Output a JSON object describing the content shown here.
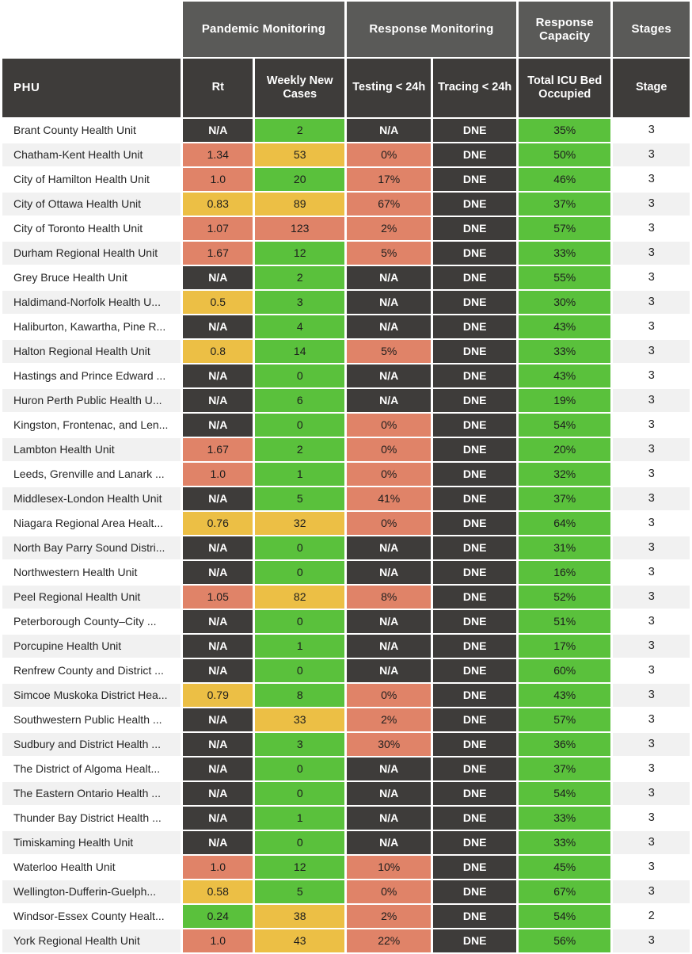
{
  "header": {
    "groups": [
      {
        "label": "",
        "key": "blank"
      },
      {
        "label": "Pandemic Monitoring",
        "key": "pandemic"
      },
      {
        "label": "Response Monitoring",
        "key": "response"
      },
      {
        "label": "Response Capacity",
        "key": "capacity"
      },
      {
        "label": "Stages",
        "key": "stages"
      }
    ],
    "columns": [
      {
        "label": "PHU"
      },
      {
        "label": "Rt"
      },
      {
        "label": "Weekly New Cases"
      },
      {
        "label": "Testing < 24h"
      },
      {
        "label": "Tracing < 24h"
      },
      {
        "label": "Total ICU Bed Occupied"
      },
      {
        "label": "Stage"
      }
    ]
  },
  "colors": {
    "green": "#5ac13c",
    "yellow": "#ecbf45",
    "red": "#e08368",
    "dark": "#3e3c3a",
    "group_header": "#5a5a58",
    "row_alt": "#f1f1f1",
    "page_background": "#ffffff"
  },
  "rows": [
    {
      "phu": "Brant County Health Unit",
      "rt": "N/A",
      "rt_c": "dark",
      "cases": "2",
      "cases_c": "green",
      "testing": "N/A",
      "testing_c": "dark",
      "tracing": "DNE",
      "tracing_c": "dark",
      "icu": "35%",
      "icu_c": "green",
      "stage": "3"
    },
    {
      "phu": "Chatham-Kent Health Unit",
      "rt": "1.34",
      "rt_c": "red",
      "cases": "53",
      "cases_c": "yellow",
      "testing": "0%",
      "testing_c": "red",
      "tracing": "DNE",
      "tracing_c": "dark",
      "icu": "50%",
      "icu_c": "green",
      "stage": "3"
    },
    {
      "phu": "City of Hamilton Health Unit",
      "rt": "1.0",
      "rt_c": "red",
      "cases": "20",
      "cases_c": "green",
      "testing": "17%",
      "testing_c": "red",
      "tracing": "DNE",
      "tracing_c": "dark",
      "icu": "46%",
      "icu_c": "green",
      "stage": "3"
    },
    {
      "phu": "City of Ottawa Health Unit",
      "rt": "0.83",
      "rt_c": "yellow",
      "cases": "89",
      "cases_c": "yellow",
      "testing": "67%",
      "testing_c": "red",
      "tracing": "DNE",
      "tracing_c": "dark",
      "icu": "37%",
      "icu_c": "green",
      "stage": "3"
    },
    {
      "phu": "City of Toronto Health Unit",
      "rt": "1.07",
      "rt_c": "red",
      "cases": "123",
      "cases_c": "red",
      "testing": "2%",
      "testing_c": "red",
      "tracing": "DNE",
      "tracing_c": "dark",
      "icu": "57%",
      "icu_c": "green",
      "stage": "3"
    },
    {
      "phu": "Durham Regional Health Unit",
      "rt": "1.67",
      "rt_c": "red",
      "cases": "12",
      "cases_c": "green",
      "testing": "5%",
      "testing_c": "red",
      "tracing": "DNE",
      "tracing_c": "dark",
      "icu": "33%",
      "icu_c": "green",
      "stage": "3"
    },
    {
      "phu": "Grey Bruce Health Unit",
      "rt": "N/A",
      "rt_c": "dark",
      "cases": "2",
      "cases_c": "green",
      "testing": "N/A",
      "testing_c": "dark",
      "tracing": "DNE",
      "tracing_c": "dark",
      "icu": "55%",
      "icu_c": "green",
      "stage": "3"
    },
    {
      "phu": "Haldimand-Norfolk Health U...",
      "rt": "0.5",
      "rt_c": "yellow",
      "cases": "3",
      "cases_c": "green",
      "testing": "N/A",
      "testing_c": "dark",
      "tracing": "DNE",
      "tracing_c": "dark",
      "icu": "30%",
      "icu_c": "green",
      "stage": "3"
    },
    {
      "phu": "Haliburton, Kawartha, Pine R...",
      "rt": "N/A",
      "rt_c": "dark",
      "cases": "4",
      "cases_c": "green",
      "testing": "N/A",
      "testing_c": "dark",
      "tracing": "DNE",
      "tracing_c": "dark",
      "icu": "43%",
      "icu_c": "green",
      "stage": "3"
    },
    {
      "phu": "Halton Regional Health Unit",
      "rt": "0.8",
      "rt_c": "yellow",
      "cases": "14",
      "cases_c": "green",
      "testing": "5%",
      "testing_c": "red",
      "tracing": "DNE",
      "tracing_c": "dark",
      "icu": "33%",
      "icu_c": "green",
      "stage": "3"
    },
    {
      "phu": "Hastings and Prince Edward ...",
      "rt": "N/A",
      "rt_c": "dark",
      "cases": "0",
      "cases_c": "green",
      "testing": "N/A",
      "testing_c": "dark",
      "tracing": "DNE",
      "tracing_c": "dark",
      "icu": "43%",
      "icu_c": "green",
      "stage": "3"
    },
    {
      "phu": "Huron Perth Public Health U...",
      "rt": "N/A",
      "rt_c": "dark",
      "cases": "6",
      "cases_c": "green",
      "testing": "N/A",
      "testing_c": "dark",
      "tracing": "DNE",
      "tracing_c": "dark",
      "icu": "19%",
      "icu_c": "green",
      "stage": "3"
    },
    {
      "phu": "Kingston, Frontenac, and Len...",
      "rt": "N/A",
      "rt_c": "dark",
      "cases": "0",
      "cases_c": "green",
      "testing": "0%",
      "testing_c": "red",
      "tracing": "DNE",
      "tracing_c": "dark",
      "icu": "54%",
      "icu_c": "green",
      "stage": "3"
    },
    {
      "phu": "Lambton Health Unit",
      "rt": "1.67",
      "rt_c": "red",
      "cases": "2",
      "cases_c": "green",
      "testing": "0%",
      "testing_c": "red",
      "tracing": "DNE",
      "tracing_c": "dark",
      "icu": "20%",
      "icu_c": "green",
      "stage": "3"
    },
    {
      "phu": "Leeds, Grenville and Lanark ...",
      "rt": "1.0",
      "rt_c": "red",
      "cases": "1",
      "cases_c": "green",
      "testing": "0%",
      "testing_c": "red",
      "tracing": "DNE",
      "tracing_c": "dark",
      "icu": "32%",
      "icu_c": "green",
      "stage": "3"
    },
    {
      "phu": "Middlesex-London Health Unit",
      "rt": "N/A",
      "rt_c": "dark",
      "cases": "5",
      "cases_c": "green",
      "testing": "41%",
      "testing_c": "red",
      "tracing": "DNE",
      "tracing_c": "dark",
      "icu": "37%",
      "icu_c": "green",
      "stage": "3"
    },
    {
      "phu": "Niagara Regional Area Healt...",
      "rt": "0.76",
      "rt_c": "yellow",
      "cases": "32",
      "cases_c": "yellow",
      "testing": "0%",
      "testing_c": "red",
      "tracing": "DNE",
      "tracing_c": "dark",
      "icu": "64%",
      "icu_c": "green",
      "stage": "3"
    },
    {
      "phu": "North Bay Parry Sound Distri...",
      "rt": "N/A",
      "rt_c": "dark",
      "cases": "0",
      "cases_c": "green",
      "testing": "N/A",
      "testing_c": "dark",
      "tracing": "DNE",
      "tracing_c": "dark",
      "icu": "31%",
      "icu_c": "green",
      "stage": "3"
    },
    {
      "phu": "Northwestern Health Unit",
      "rt": "N/A",
      "rt_c": "dark",
      "cases": "0",
      "cases_c": "green",
      "testing": "N/A",
      "testing_c": "dark",
      "tracing": "DNE",
      "tracing_c": "dark",
      "icu": "16%",
      "icu_c": "green",
      "stage": "3"
    },
    {
      "phu": "Peel Regional Health Unit",
      "rt": "1.05",
      "rt_c": "red",
      "cases": "82",
      "cases_c": "yellow",
      "testing": "8%",
      "testing_c": "red",
      "tracing": "DNE",
      "tracing_c": "dark",
      "icu": "52%",
      "icu_c": "green",
      "stage": "3"
    },
    {
      "phu": "Peterborough County–City ...",
      "rt": "N/A",
      "rt_c": "dark",
      "cases": "0",
      "cases_c": "green",
      "testing": "N/A",
      "testing_c": "dark",
      "tracing": "DNE",
      "tracing_c": "dark",
      "icu": "51%",
      "icu_c": "green",
      "stage": "3"
    },
    {
      "phu": "Porcupine Health Unit",
      "rt": "N/A",
      "rt_c": "dark",
      "cases": "1",
      "cases_c": "green",
      "testing": "N/A",
      "testing_c": "dark",
      "tracing": "DNE",
      "tracing_c": "dark",
      "icu": "17%",
      "icu_c": "green",
      "stage": "3"
    },
    {
      "phu": "Renfrew County and District ...",
      "rt": "N/A",
      "rt_c": "dark",
      "cases": "0",
      "cases_c": "green",
      "testing": "N/A",
      "testing_c": "dark",
      "tracing": "DNE",
      "tracing_c": "dark",
      "icu": "60%",
      "icu_c": "green",
      "stage": "3"
    },
    {
      "phu": "Simcoe Muskoka District Hea...",
      "rt": "0.79",
      "rt_c": "yellow",
      "cases": "8",
      "cases_c": "green",
      "testing": "0%",
      "testing_c": "red",
      "tracing": "DNE",
      "tracing_c": "dark",
      "icu": "43%",
      "icu_c": "green",
      "stage": "3"
    },
    {
      "phu": "Southwestern Public Health ...",
      "rt": "N/A",
      "rt_c": "dark",
      "cases": "33",
      "cases_c": "yellow",
      "testing": "2%",
      "testing_c": "red",
      "tracing": "DNE",
      "tracing_c": "dark",
      "icu": "57%",
      "icu_c": "green",
      "stage": "3"
    },
    {
      "phu": "Sudbury and District Health ...",
      "rt": "N/A",
      "rt_c": "dark",
      "cases": "3",
      "cases_c": "green",
      "testing": "30%",
      "testing_c": "red",
      "tracing": "DNE",
      "tracing_c": "dark",
      "icu": "36%",
      "icu_c": "green",
      "stage": "3"
    },
    {
      "phu": "The District of Algoma Healt...",
      "rt": "N/A",
      "rt_c": "dark",
      "cases": "0",
      "cases_c": "green",
      "testing": "N/A",
      "testing_c": "dark",
      "tracing": "DNE",
      "tracing_c": "dark",
      "icu": "37%",
      "icu_c": "green",
      "stage": "3"
    },
    {
      "phu": "The Eastern Ontario Health ...",
      "rt": "N/A",
      "rt_c": "dark",
      "cases": "0",
      "cases_c": "green",
      "testing": "N/A",
      "testing_c": "dark",
      "tracing": "DNE",
      "tracing_c": "dark",
      "icu": "54%",
      "icu_c": "green",
      "stage": "3"
    },
    {
      "phu": "Thunder Bay District Health ...",
      "rt": "N/A",
      "rt_c": "dark",
      "cases": "1",
      "cases_c": "green",
      "testing": "N/A",
      "testing_c": "dark",
      "tracing": "DNE",
      "tracing_c": "dark",
      "icu": "33%",
      "icu_c": "green",
      "stage": "3"
    },
    {
      "phu": "Timiskaming Health Unit",
      "rt": "N/A",
      "rt_c": "dark",
      "cases": "0",
      "cases_c": "green",
      "testing": "N/A",
      "testing_c": "dark",
      "tracing": "DNE",
      "tracing_c": "dark",
      "icu": "33%",
      "icu_c": "green",
      "stage": "3"
    },
    {
      "phu": "Waterloo Health Unit",
      "rt": "1.0",
      "rt_c": "red",
      "cases": "12",
      "cases_c": "green",
      "testing": "10%",
      "testing_c": "red",
      "tracing": "DNE",
      "tracing_c": "dark",
      "icu": "45%",
      "icu_c": "green",
      "stage": "3"
    },
    {
      "phu": "Wellington-Dufferin-Guelph...",
      "rt": "0.58",
      "rt_c": "yellow",
      "cases": "5",
      "cases_c": "green",
      "testing": "0%",
      "testing_c": "red",
      "tracing": "DNE",
      "tracing_c": "dark",
      "icu": "67%",
      "icu_c": "green",
      "stage": "3"
    },
    {
      "phu": "Windsor-Essex County Healt...",
      "rt": "0.24",
      "rt_c": "green",
      "cases": "38",
      "cases_c": "yellow",
      "testing": "2%",
      "testing_c": "red",
      "tracing": "DNE",
      "tracing_c": "dark",
      "icu": "54%",
      "icu_c": "green",
      "stage": "2"
    },
    {
      "phu": "York Regional Health Unit",
      "rt": "1.0",
      "rt_c": "red",
      "cases": "43",
      "cases_c": "yellow",
      "testing": "22%",
      "testing_c": "red",
      "tracing": "DNE",
      "tracing_c": "dark",
      "icu": "56%",
      "icu_c": "green",
      "stage": "3"
    }
  ]
}
